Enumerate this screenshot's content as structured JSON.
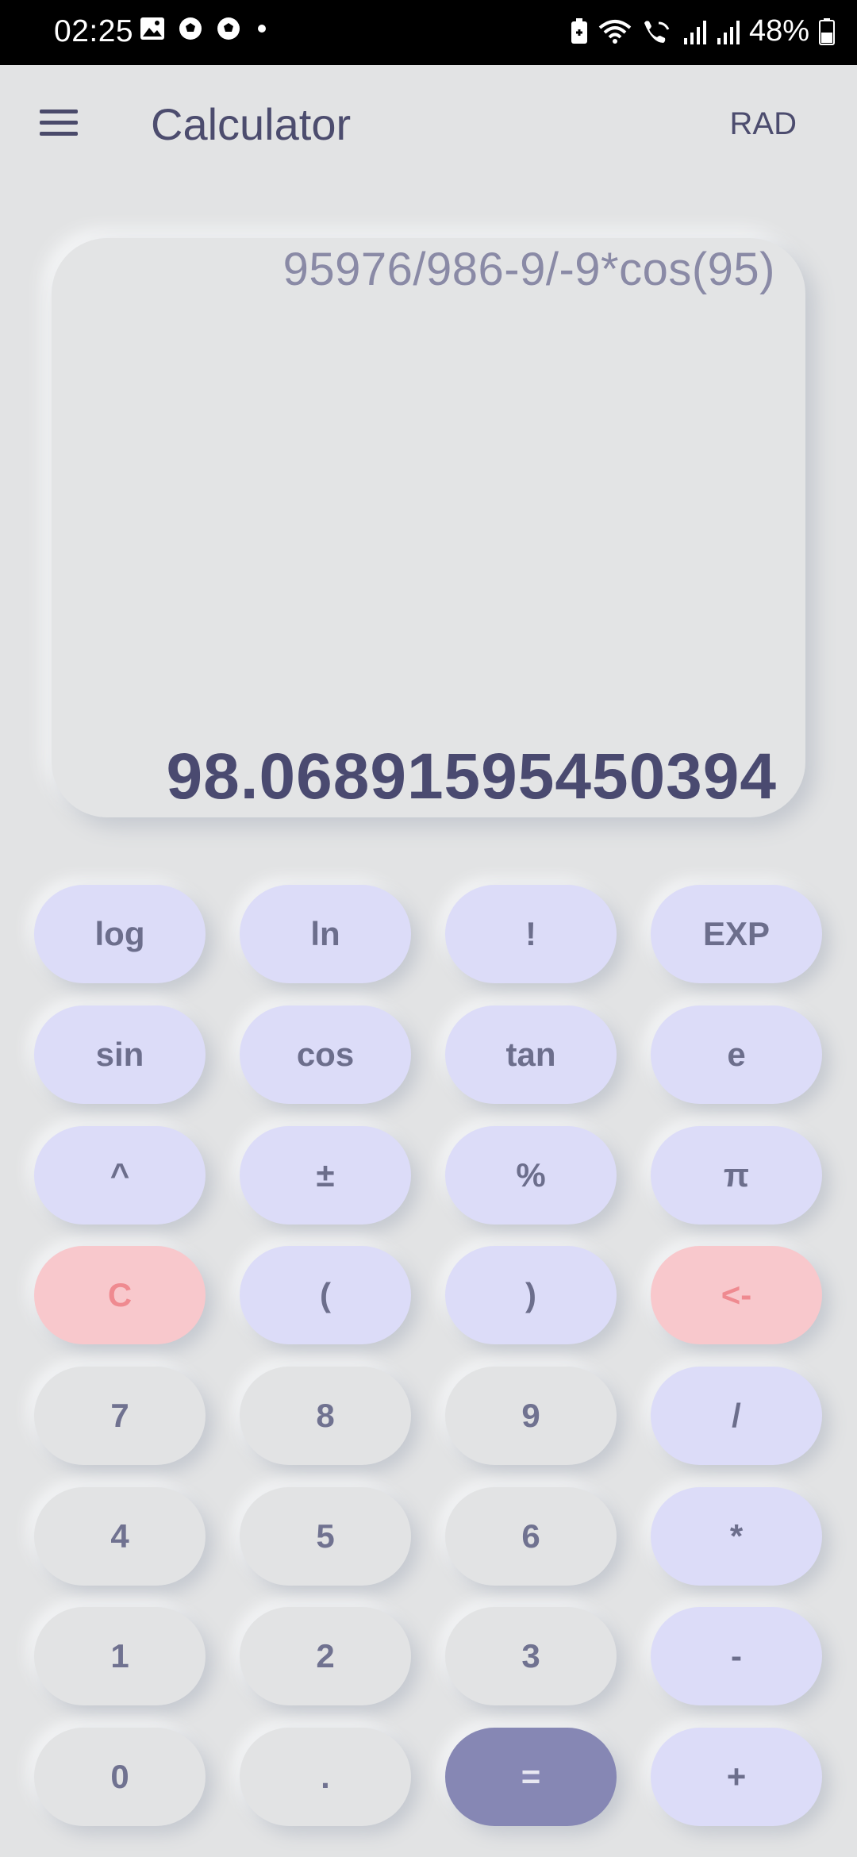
{
  "status_bar": {
    "time": "02:25",
    "battery": "48%",
    "left_icons": [
      "image-icon",
      "soccer-ball-icon",
      "soccer-ball-icon",
      "dot-icon"
    ],
    "right_icons": [
      "battery-saver-icon",
      "wifi-icon",
      "wifi-calling-icon",
      "signal-icon",
      "signal-icon",
      "battery-icon"
    ]
  },
  "app_bar": {
    "menu_icon": "hamburger-menu-icon",
    "title": "Calculator",
    "angle_mode": "RAD"
  },
  "display": {
    "expression": "95976/986-9/-9*cos(95)",
    "result": "98.06891595450394"
  },
  "keypad": {
    "rows": [
      [
        "log",
        "ln",
        "!",
        "EXP"
      ],
      [
        "sin",
        "cos",
        "tan",
        "e"
      ],
      [
        "^",
        "±",
        "%",
        "π"
      ],
      [
        "C",
        "(",
        ")",
        "<-"
      ],
      [
        "7",
        "8",
        "9",
        "/"
      ],
      [
        "4",
        "5",
        "6",
        "*"
      ],
      [
        "1",
        "2",
        "3",
        "-"
      ],
      [
        "0",
        ".",
        "=",
        "+"
      ]
    ]
  },
  "colors": {
    "background": "#e2e3e4",
    "function_key": "#dcdcf8",
    "clear_key": "#f8c8cc",
    "equals_key": "#8687b4",
    "text_primary": "#4a4a70"
  }
}
